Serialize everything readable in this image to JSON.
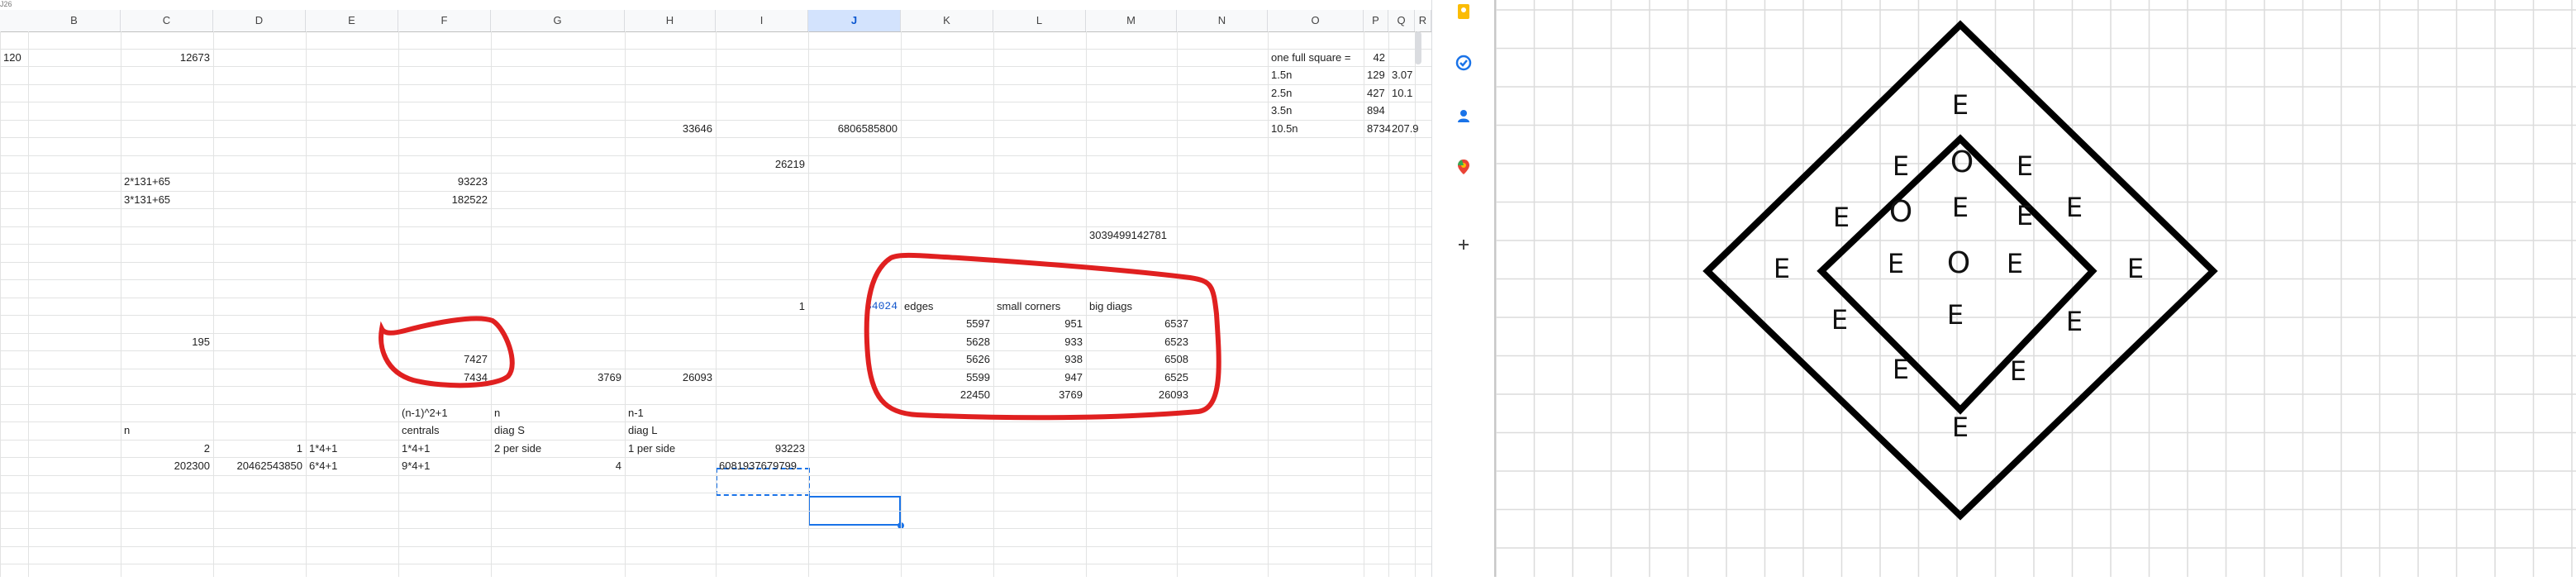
{
  "spreadsheet": {
    "name_box": "J26",
    "columns": [
      "B",
      "C",
      "D",
      "E",
      "F",
      "G",
      "H",
      "I",
      "J",
      "K",
      "L",
      "M",
      "N",
      "O",
      "P",
      "Q",
      "R"
    ],
    "selected_column": "J",
    "cells": [
      {
        "col": "A",
        "row": 2,
        "v": "120",
        "align": "left"
      },
      {
        "col": "C",
        "row": 2,
        "v": "12673",
        "align": "right"
      },
      {
        "col": "O",
        "row": 2,
        "v": "one full square =",
        "align": "left"
      },
      {
        "col": "P",
        "row": 2,
        "v": "42",
        "align": "right"
      },
      {
        "col": "O",
        "row": 3,
        "v": "1.5n",
        "align": "left"
      },
      {
        "col": "P",
        "row": 3,
        "v": "129",
        "align": "left"
      },
      {
        "col": "Q",
        "row": 3,
        "v": "3.07",
        "align": "left"
      },
      {
        "col": "O",
        "row": 4,
        "v": "2.5n",
        "align": "left"
      },
      {
        "col": "P",
        "row": 4,
        "v": "427",
        "align": "left"
      },
      {
        "col": "Q",
        "row": 4,
        "v": "10.1",
        "align": "left"
      },
      {
        "col": "O",
        "row": 5,
        "v": "3.5n",
        "align": "left"
      },
      {
        "col": "P",
        "row": 5,
        "v": "894",
        "align": "left"
      },
      {
        "col": "H",
        "row": 6,
        "v": "33646",
        "align": "right"
      },
      {
        "col": "J",
        "row": 6,
        "v": "6806585800",
        "align": "right"
      },
      {
        "col": "O",
        "row": 6,
        "v": "10.5n",
        "align": "left"
      },
      {
        "col": "P",
        "row": 6,
        "v": "8734",
        "align": "left"
      },
      {
        "col": "Q",
        "row": 6,
        "v": "207.9",
        "align": "left"
      },
      {
        "col": "I",
        "row": 8,
        "v": "26219",
        "align": "right"
      },
      {
        "col": "C",
        "row": 9,
        "v": "2*131+65",
        "align": "left"
      },
      {
        "col": "F",
        "row": 9,
        "v": "93223",
        "align": "right"
      },
      {
        "col": "C",
        "row": 10,
        "v": "3*131+65",
        "align": "left"
      },
      {
        "col": "F",
        "row": 10,
        "v": "182522",
        "align": "right"
      },
      {
        "col": "M",
        "row": 12,
        "v": "3039499142781",
        "align": "left"
      },
      {
        "col": "I",
        "row": 16,
        "v": "1",
        "align": "right"
      },
      {
        "col": "J",
        "row": 16,
        "v": "34024",
        "align": "right",
        "cls": "blue"
      },
      {
        "col": "K",
        "row": 16,
        "v": "edges",
        "align": "left"
      },
      {
        "col": "L",
        "row": 16,
        "v": "small corners",
        "align": "left"
      },
      {
        "col": "M",
        "row": 16,
        "v": "big diags",
        "align": "left"
      },
      {
        "col": "K",
        "row": 17,
        "v": "5597",
        "align": "right"
      },
      {
        "col": "L",
        "row": 17,
        "v": "951",
        "align": "right"
      },
      {
        "col": "M",
        "row": 17,
        "v": "6537",
        "align": "right"
      },
      {
        "col": "C",
        "row": 18,
        "v": "195",
        "align": "right"
      },
      {
        "col": "K",
        "row": 18,
        "v": "5628",
        "align": "right"
      },
      {
        "col": "L",
        "row": 18,
        "v": "933",
        "align": "right"
      },
      {
        "col": "M",
        "row": 18,
        "v": "6523",
        "align": "right"
      },
      {
        "col": "F",
        "row": 19,
        "v": "7427",
        "align": "right"
      },
      {
        "col": "K",
        "row": 19,
        "v": "5626",
        "align": "right"
      },
      {
        "col": "L",
        "row": 19,
        "v": "938",
        "align": "right"
      },
      {
        "col": "M",
        "row": 19,
        "v": "6508",
        "align": "right"
      },
      {
        "col": "F",
        "row": 20,
        "v": "7434",
        "align": "right"
      },
      {
        "col": "G",
        "row": 20,
        "v": "3769",
        "align": "right"
      },
      {
        "col": "H",
        "row": 20,
        "v": "26093",
        "align": "right"
      },
      {
        "col": "K",
        "row": 20,
        "v": "5599",
        "align": "right"
      },
      {
        "col": "L",
        "row": 20,
        "v": "947",
        "align": "right"
      },
      {
        "col": "M",
        "row": 20,
        "v": "6525",
        "align": "right"
      },
      {
        "col": "K",
        "row": 21,
        "v": "22450",
        "align": "right"
      },
      {
        "col": "L",
        "row": 21,
        "v": "3769",
        "align": "right"
      },
      {
        "col": "M",
        "row": 21,
        "v": "26093",
        "align": "right"
      },
      {
        "col": "F",
        "row": 22,
        "v": "(n-1)^2+1",
        "align": "left"
      },
      {
        "col": "G",
        "row": 22,
        "v": "n",
        "align": "left"
      },
      {
        "col": "H",
        "row": 22,
        "v": "n-1",
        "align": "left"
      },
      {
        "col": "C",
        "row": 23,
        "v": "n",
        "align": "left"
      },
      {
        "col": "F",
        "row": 23,
        "v": "centrals",
        "align": "left"
      },
      {
        "col": "G",
        "row": 23,
        "v": "diag S",
        "align": "left"
      },
      {
        "col": "H",
        "row": 23,
        "v": "diag L",
        "align": "left"
      },
      {
        "col": "C",
        "row": 24,
        "v": "2",
        "align": "right"
      },
      {
        "col": "D",
        "row": 24,
        "v": "1",
        "align": "right"
      },
      {
        "col": "E",
        "row": 24,
        "v": "1*4+1",
        "align": "left"
      },
      {
        "col": "F",
        "row": 24,
        "v": "1*4+1",
        "align": "left"
      },
      {
        "col": "G",
        "row": 24,
        "v": "2 per side",
        "align": "left"
      },
      {
        "col": "H",
        "row": 24,
        "v": "1 per side",
        "align": "left"
      },
      {
        "col": "I",
        "row": 24,
        "v": "93223",
        "align": "right"
      },
      {
        "col": "C",
        "row": 25,
        "v": "202300",
        "align": "right"
      },
      {
        "col": "D",
        "row": 25,
        "v": "20462543850",
        "align": "right"
      },
      {
        "col": "E",
        "row": 25,
        "v": "6*4+1",
        "align": "left"
      },
      {
        "col": "F",
        "row": 25,
        "v": "9*4+1",
        "align": "left"
      },
      {
        "col": "G",
        "row": 25,
        "v": "4",
        "align": "right"
      },
      {
        "col": "I",
        "row": 25,
        "v": "6081937679799",
        "align": "left"
      }
    ]
  },
  "side_panel": {
    "icons": [
      "keep-icon",
      "tasks-icon",
      "contacts-icon",
      "maps-icon",
      "add-icon"
    ]
  },
  "drawing": {
    "letters": [
      "E",
      "E",
      "O",
      "E",
      "E",
      "O",
      "E",
      "E",
      "E",
      "E",
      "O",
      "E",
      "E",
      "E",
      "E",
      "E",
      "E",
      "E",
      "E",
      "E"
    ]
  },
  "colors": {
    "accent": "#1a73e8",
    "annotation_red": "#e02020",
    "header_bg": "#f8f9fa"
  }
}
